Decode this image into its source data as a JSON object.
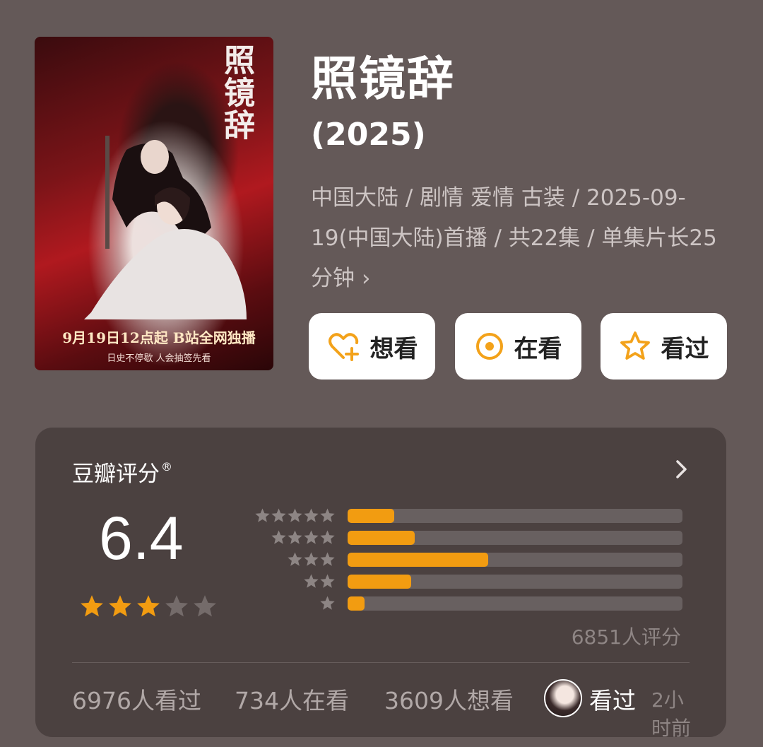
{
  "poster": {
    "vertical_title": "照镜辞",
    "subtitle": "9月19日12点起 B站全网独播",
    "tagline": "日史不停歇 人会抽签先看"
  },
  "title": "照镜辞",
  "year": "(2025)",
  "meta_text": "中国大陆 / 剧情 爱情 古装 / 2025-09-19(中国大陆)首播 / 共22集 / 单集片长25分钟",
  "meta_chevron": "›",
  "buttons": {
    "want": {
      "label": "想看",
      "icon": "heart-plus-icon"
    },
    "watching": {
      "label": "在看",
      "icon": "target-icon"
    },
    "watched": {
      "label": "看过",
      "icon": "star-outline-icon"
    }
  },
  "rating": {
    "title": "豆瓣评分",
    "registered_mark": "®",
    "score": "6.4",
    "score_stars": 3,
    "accent_color": "#f29c11",
    "distribution": [
      {
        "stars": 5,
        "fraction": 0.14
      },
      {
        "stars": 4,
        "fraction": 0.2
      },
      {
        "stars": 3,
        "fraction": 0.42
      },
      {
        "stars": 2,
        "fraction": 0.19
      },
      {
        "stars": 1,
        "fraction": 0.05
      }
    ],
    "count_label": "6851人评分"
  },
  "footer": {
    "watched_count": "6976人看过",
    "watching_count": "734人在看",
    "want_count": "3609人想看",
    "friend_action": "看过",
    "friend_time": "2小时前"
  }
}
